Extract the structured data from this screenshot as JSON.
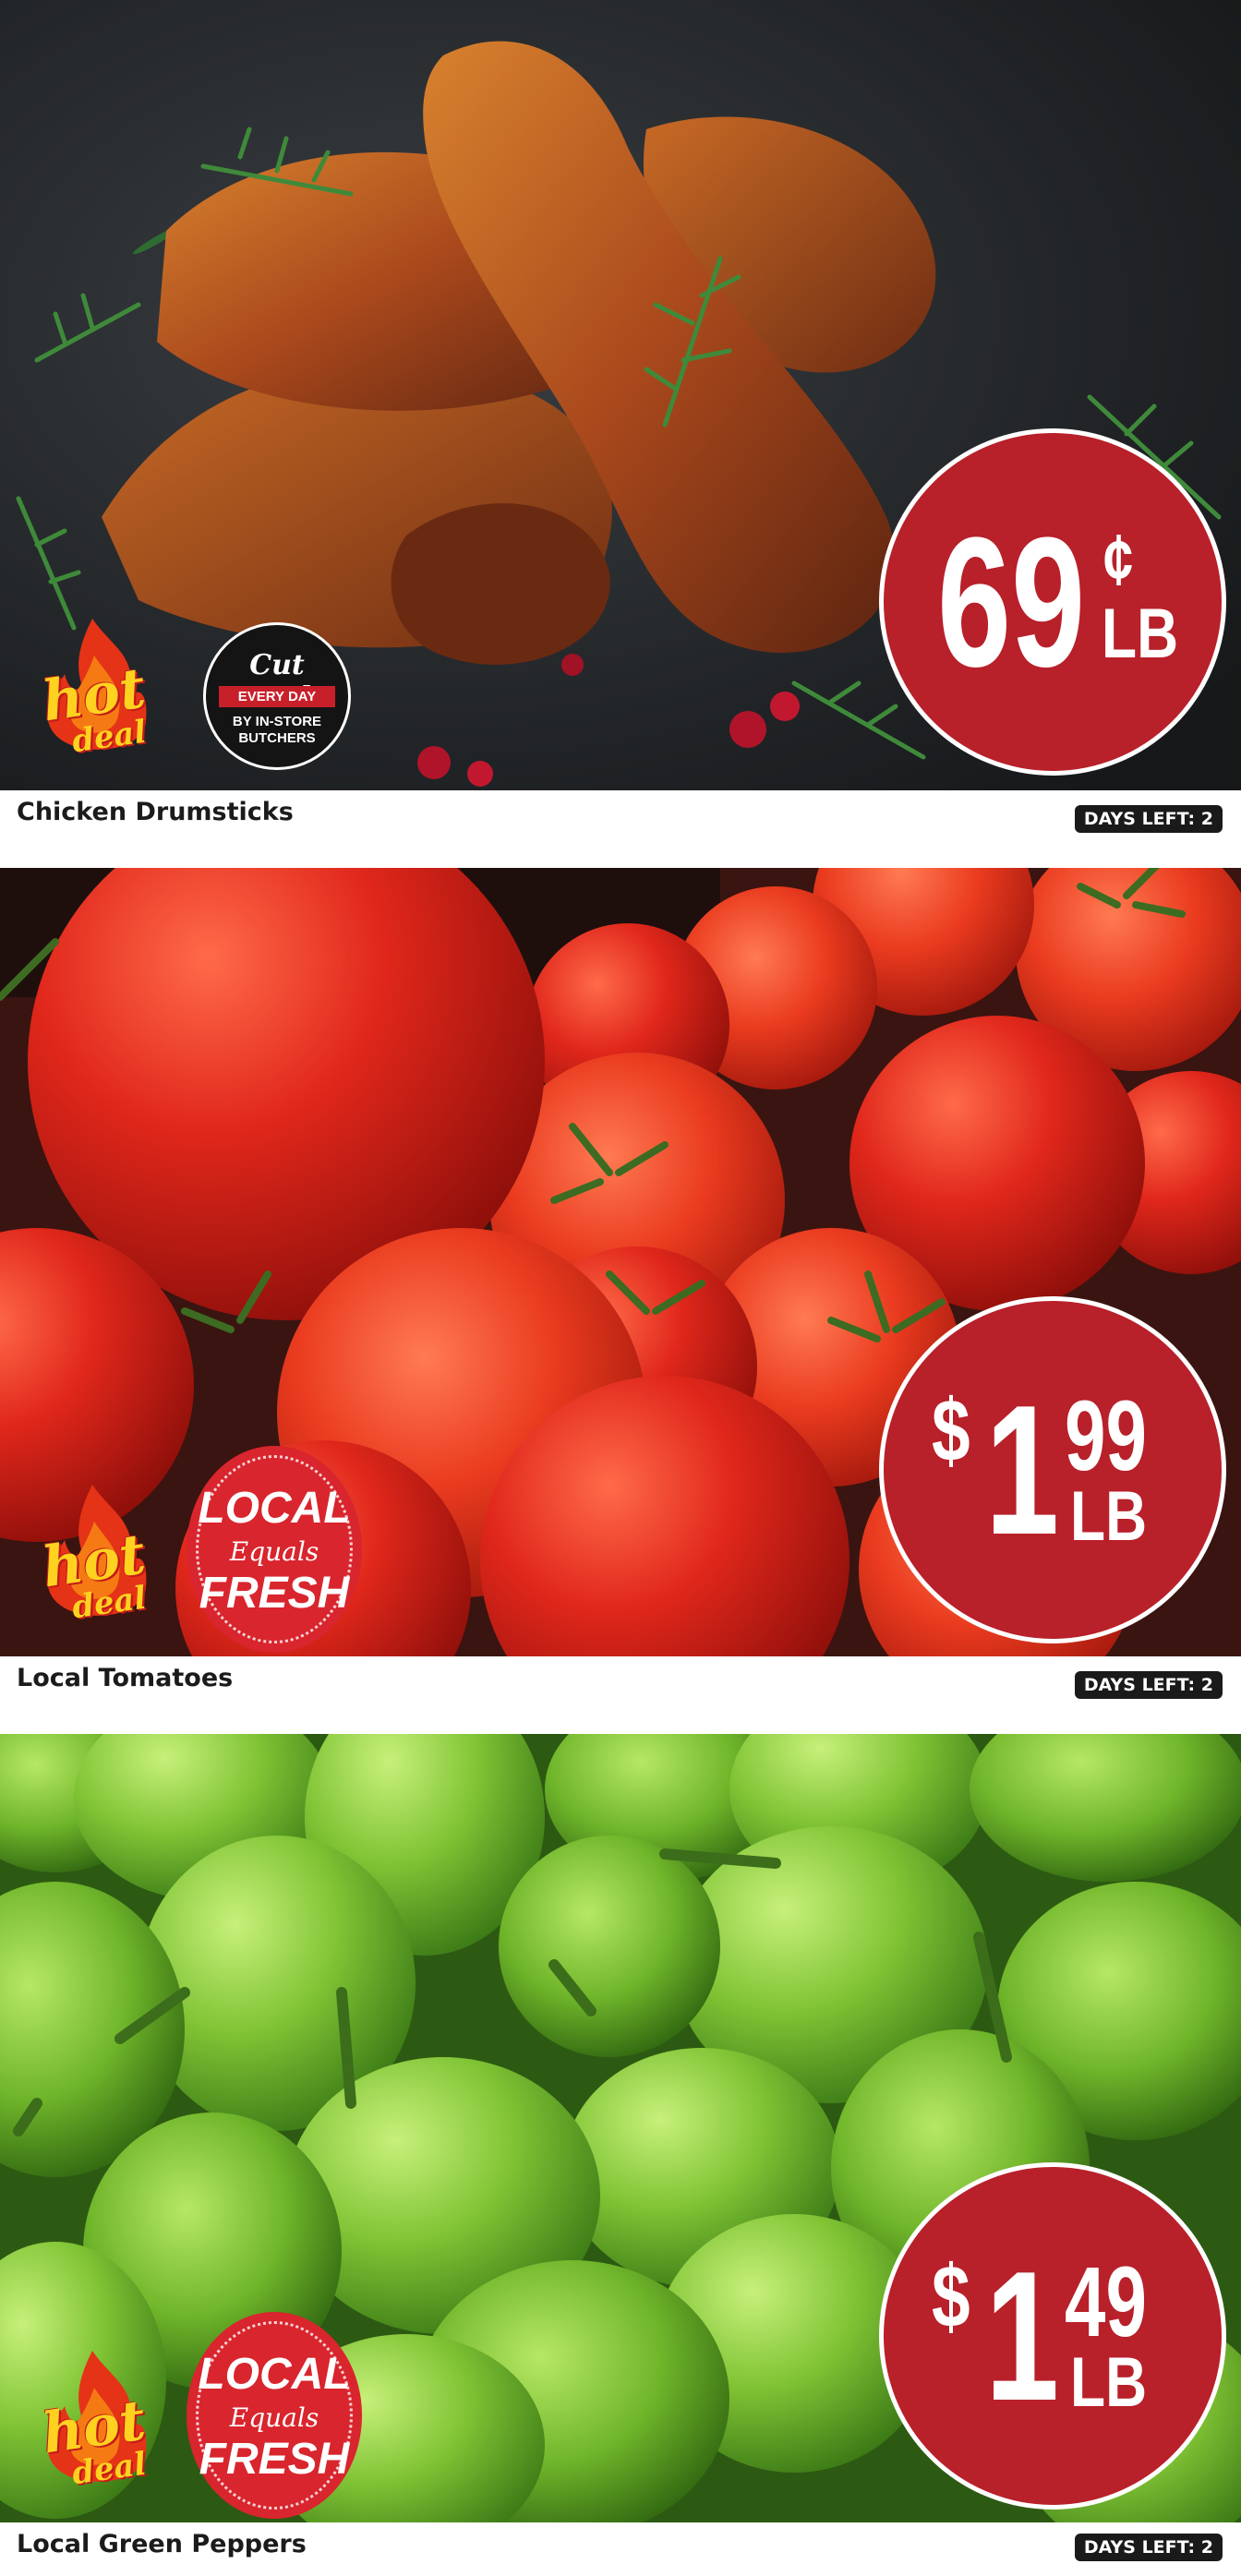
{
  "items": [
    {
      "name": "Chicken Drumsticks",
      "days_left": "DAYS LEFT: 2",
      "price": {
        "dollar": "",
        "main": "69",
        "cents": "¢",
        "unit": "LB"
      },
      "promo_hot": {
        "word1": "hot",
        "word2": "deal"
      },
      "badge": {
        "title": "Cut Fresh",
        "band": "EVERY DAY",
        "line1": "BY IN-STORE",
        "line2": "BUTCHERS"
      }
    },
    {
      "name": "Local Tomatoes",
      "days_left": "DAYS LEFT: 2",
      "price": {
        "dollar": "$",
        "main": "1",
        "cents": "99",
        "unit": "LB"
      },
      "promo_hot": {
        "word1": "hot",
        "word2": "deal"
      },
      "badge": {
        "top": "LOCAL",
        "mid": "Equals",
        "bottom": "FRESH"
      }
    },
    {
      "name": "Local Green Peppers",
      "days_left": "DAYS LEFT: 2",
      "price": {
        "dollar": "$",
        "main": "1",
        "cents": "49",
        "unit": "LB"
      },
      "promo_hot": {
        "word1": "hot",
        "word2": "deal"
      },
      "badge": {
        "top": "LOCAL",
        "mid": "Equals",
        "bottom": "FRESH"
      }
    }
  ],
  "colors": {
    "price_red": "#b8202a",
    "local_red": "#d9252d",
    "hot_yellow": "#ffd21f",
    "pill_dark": "#1a1a1a"
  }
}
